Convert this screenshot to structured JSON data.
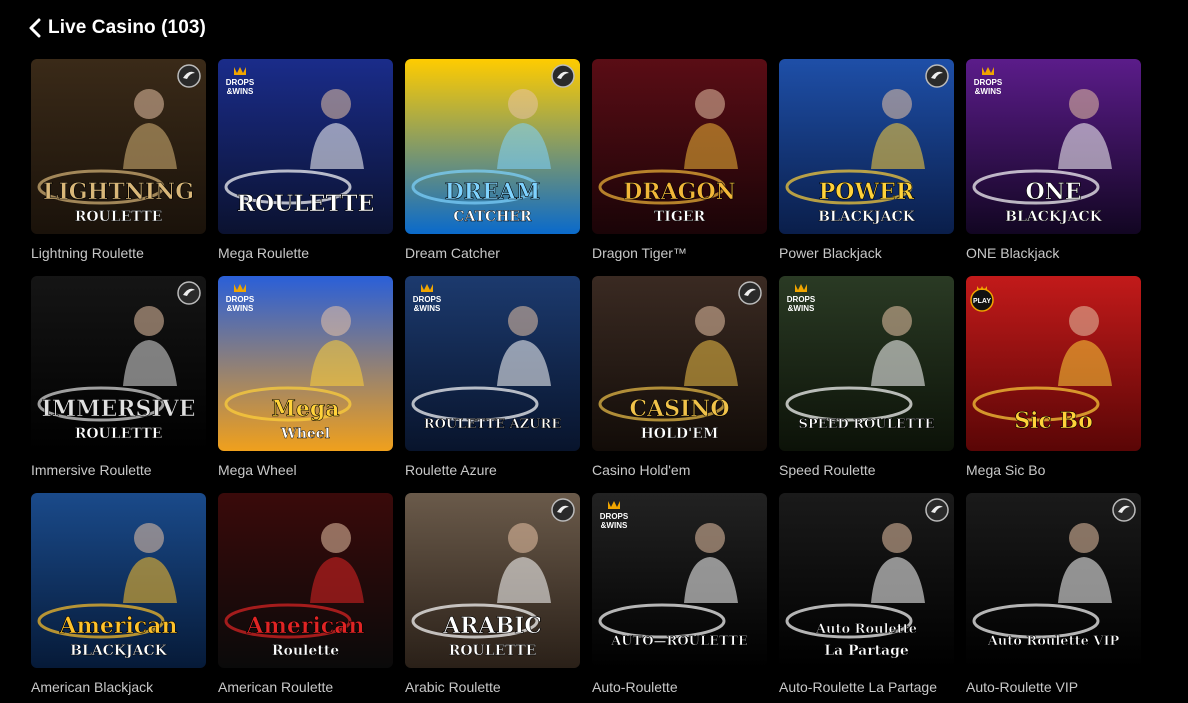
{
  "header": {
    "title": "Live Casino (103)"
  },
  "colors": {
    "background": "#000000",
    "label": "#c8c8c8"
  },
  "tiles": [
    {
      "name": "Lightning Roulette",
      "art": "LIGHTNING",
      "art2": "ROULETTE",
      "bg": [
        "#3a2a18",
        "#1a120a"
      ],
      "accent": "#d9b779",
      "badge": "none",
      "corner": "chip"
    },
    {
      "name": "Mega Roulette",
      "art": "ROULETTE",
      "art2": "",
      "bg": [
        "#1a2c8a",
        "#0b1230"
      ],
      "accent": "#ffffff",
      "badge": "drops",
      "corner": "none"
    },
    {
      "name": "Dream Catcher",
      "art": "DREAM",
      "art2": "CATCHER",
      "bg": [
        "#ffcc00",
        "#0a6acb"
      ],
      "accent": "#7fd3ff",
      "badge": "none",
      "corner": "chip"
    },
    {
      "name": "Dragon Tiger™",
      "art": "DRAGON",
      "art2": "TIGER",
      "bg": [
        "#5a0d15",
        "#1a0407"
      ],
      "accent": "#f2b739",
      "badge": "none",
      "corner": "none"
    },
    {
      "name": "Power Blackjack",
      "art": "POWER",
      "art2": "BLACKJACK",
      "bg": [
        "#1e4fa8",
        "#0a1e4a"
      ],
      "accent": "#ffd23a",
      "badge": "none",
      "corner": "chip"
    },
    {
      "name": "ONE Blackjack",
      "art": "ONE",
      "art2": "BLACKJACK",
      "bg": [
        "#5b1c8a",
        "#120622"
      ],
      "accent": "#ffffff",
      "badge": "drops",
      "corner": "none"
    },
    {
      "name": "Immersive Roulette",
      "art": "IMMERSIVE",
      "art2": "ROULETTE",
      "bg": [
        "#151515",
        "#000000"
      ],
      "accent": "#e0e0e0",
      "badge": "none",
      "corner": "chip"
    },
    {
      "name": "Mega Wheel",
      "art": "Mega",
      "art2": "Wheel",
      "bg": [
        "#2a5fd8",
        "#f0a01c"
      ],
      "accent": "#ffd23a",
      "badge": "drops",
      "corner": "none"
    },
    {
      "name": "Roulette Azure",
      "art": "ROULETTE AZURE",
      "art2": "",
      "bg": [
        "#1c3a6e",
        "#08142c"
      ],
      "accent": "#ffffff",
      "badge": "drops",
      "corner": "none"
    },
    {
      "name": "Casino Hold'em",
      "art": "CASINO",
      "art2": "HOLD'EM",
      "bg": [
        "#3a2a22",
        "#120c08"
      ],
      "accent": "#f0c24a",
      "badge": "none",
      "corner": "chip"
    },
    {
      "name": "Speed Roulette",
      "art": "SPEED ROULETTE",
      "art2": "",
      "bg": [
        "#2a3a24",
        "#0c1208"
      ],
      "accent": "#ffffff",
      "badge": "drops",
      "corner": "none"
    },
    {
      "name": "Mega Sic Bo",
      "art": "Sic Bo",
      "art2": "",
      "bg": [
        "#c21a1a",
        "#5a0606"
      ],
      "accent": "#ffd23a",
      "badge": "play",
      "corner": "none"
    },
    {
      "name": "American Blackjack",
      "art": "American",
      "art2": "BLACKJACK",
      "bg": [
        "#1a4a8a",
        "#061a38"
      ],
      "accent": "#ffc22a",
      "badge": "none",
      "corner": "none"
    },
    {
      "name": "American Roulette",
      "art": "American",
      "art2": "Roulette",
      "bg": [
        "#3a0a0a",
        "#0a0a0a"
      ],
      "accent": "#e02424",
      "badge": "none",
      "corner": "none"
    },
    {
      "name": "Arabic Roulette",
      "art": "ARABIC",
      "art2": "ROULETTE",
      "bg": [
        "#6a5a4a",
        "#2a2018"
      ],
      "accent": "#ffffff",
      "badge": "none",
      "corner": "chip"
    },
    {
      "name": "Auto-Roulette",
      "art": "AUTO—ROULETTE",
      "art2": "",
      "bg": [
        "#222222",
        "#000000"
      ],
      "accent": "#ffffff",
      "badge": "drops",
      "corner": "none"
    },
    {
      "name": "Auto-Roulette La Partage",
      "art": "Auto Roulette",
      "art2": "La Partage",
      "bg": [
        "#1a1a1a",
        "#000000"
      ],
      "accent": "#ffffff",
      "badge": "none",
      "corner": "chip"
    },
    {
      "name": "Auto-Roulette VIP",
      "art": "Auto Roulette VIP",
      "art2": "",
      "bg": [
        "#1a1a1a",
        "#000000"
      ],
      "accent": "#ffffff",
      "badge": "none",
      "corner": "chip"
    }
  ]
}
